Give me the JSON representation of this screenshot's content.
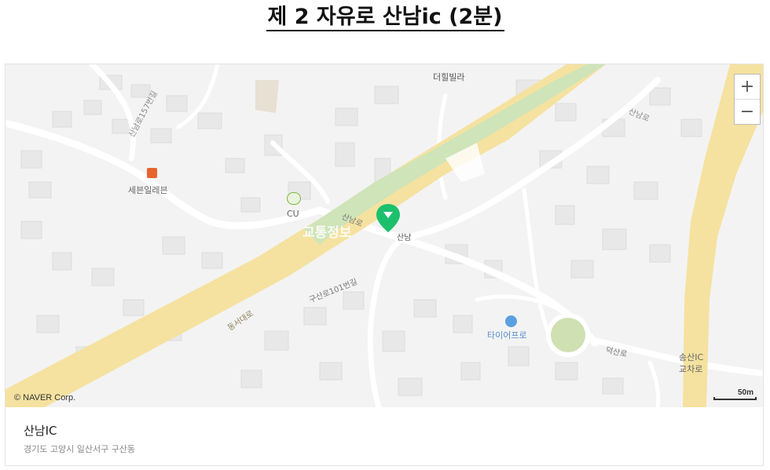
{
  "page": {
    "title": "제 2 자유로 산남ic (2분)"
  },
  "map": {
    "labels": {
      "poi_villa": "더힐빌라",
      "road_sannam_157": "산남로157번길",
      "poi_seven_eleven": "세븐일레븐",
      "poi_cu": "CU",
      "road_sannam_1": "산남로",
      "road_sannam_2": "산남로",
      "poi_sannam": "산남",
      "road_gusan_101": "구산로101번길",
      "road_dongseo": "동서대로",
      "poi_tire_pro": "타이어프로",
      "road_deoksan": "덕산로",
      "ic_songsan_1": "송산IC",
      "ic_songsan_2": "교차로"
    },
    "icons": [
      "seven-eleven-icon",
      "cu-icon",
      "location-pin-icon",
      "tire-shop-icon",
      "villa-icon"
    ],
    "zoom_in": "+",
    "zoom_out": "−",
    "copyright": "© NAVER Corp.",
    "scale": "50m",
    "watermark": "교통정보"
  },
  "place": {
    "name": "산남IC",
    "address": "경기도 고양시 일산서구 구산동"
  },
  "colors": {
    "highway": "#f7e3a1",
    "median": "#cfe4b8",
    "pin": "#1cc06c",
    "background": "#f3f3f3"
  }
}
